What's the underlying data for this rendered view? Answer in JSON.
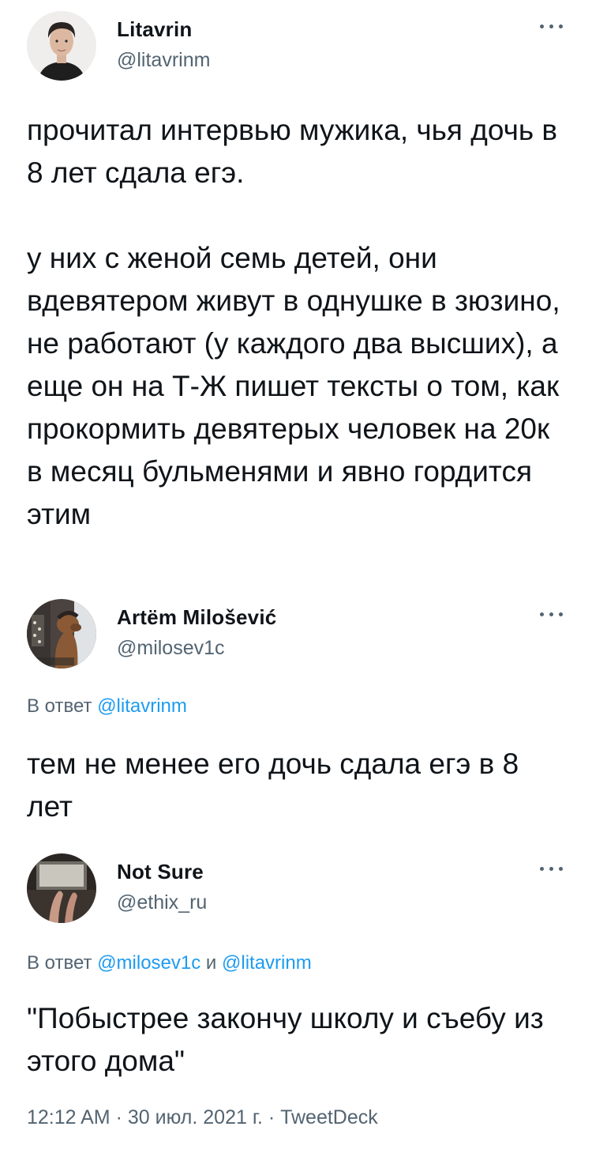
{
  "tweets": [
    {
      "display_name": "Litavrin",
      "handle": "@litavrinm",
      "text": "прочитал интервью мужика, чья дочь в 8 лет сдала егэ.\n\nу них с женой семь детей, они вдевятером живут в однушке в зюзино, не работают (у каждого два высших), а еще он на Т-Ж пишет тексты о том, как прокормить девятерых человек на 20к в месяц бульменями и явно гордится этим"
    },
    {
      "display_name": "Artëm Milošević",
      "handle": "@milosev1c",
      "reply_prefix": "В ответ",
      "reply_mentions": [
        "@litavrinm"
      ],
      "text": "тем не менее его дочь сдала егэ в 8 лет"
    },
    {
      "display_name": "Not Sure",
      "handle": "@ethix_ru",
      "reply_prefix": "В ответ",
      "reply_mentions": [
        "@milosev1c",
        "@litavrinm"
      ],
      "reply_joiner": "и",
      "text": "\"Побыстрее закончу школу и съебу из этого дома\"",
      "time": "12:12 AM",
      "separator": "·",
      "date": "30 июл. 2021 г.",
      "source": "TweetDeck"
    }
  ],
  "icons": {
    "more": "more-horizontal-icon"
  },
  "colors": {
    "text": "#0f1419",
    "secondary": "#536471",
    "link": "#1d9bf0"
  }
}
